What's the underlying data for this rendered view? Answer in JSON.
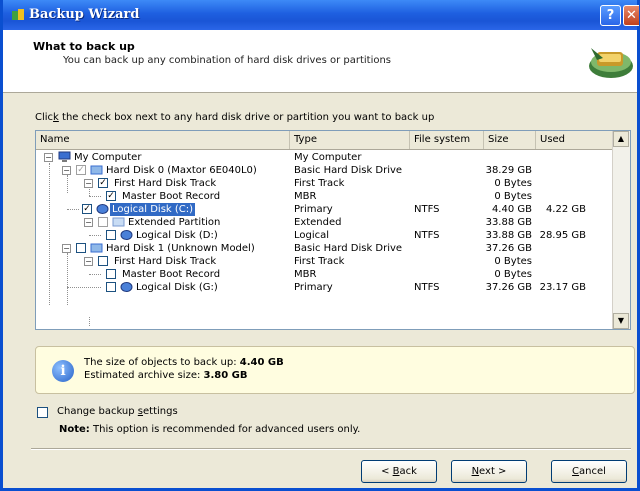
{
  "window": {
    "title": "Backup Wizard",
    "help_label": "?",
    "close_label": "✕"
  },
  "header": {
    "title": "What to back up",
    "subtitle": "You can back up any combination of hard disk drives or partitions"
  },
  "instruction": {
    "prefix": "Clic",
    "accel": "k",
    "rest": " the check box next to any hard disk drive or partition you want to back up"
  },
  "tree": {
    "columns": {
      "name": "Name",
      "type": "Type",
      "fs": "File system",
      "size": "Size",
      "used": "Used"
    },
    "rows": [
      {
        "name": "My Computer",
        "type": "My Computer",
        "fs": "",
        "size": "",
        "used": ""
      },
      {
        "name": "Hard Disk 0 (Maxtor 6E040L0)",
        "type": "Basic Hard Disk Drive",
        "fs": "",
        "size": "38.29 GB",
        "used": ""
      },
      {
        "name": "First Hard Disk Track",
        "type": "First Track",
        "fs": "",
        "size": "0 Bytes",
        "used": ""
      },
      {
        "name": "Master Boot Record",
        "type": "MBR",
        "fs": "",
        "size": "0 Bytes",
        "used": ""
      },
      {
        "name": "Logical Disk (C:)",
        "type": "Primary",
        "fs": "NTFS",
        "size": "4.40 GB",
        "used": "4.22 GB"
      },
      {
        "name": "Extended Partition",
        "type": "Extended",
        "fs": "",
        "size": "33.88 GB",
        "used": ""
      },
      {
        "name": "Logical Disk (D:)",
        "type": "Logical",
        "fs": "NTFS",
        "size": "33.88 GB",
        "used": "28.95 GB"
      },
      {
        "name": "Hard Disk 1 (Unknown Model)",
        "type": "Basic Hard Disk Drive",
        "fs": "",
        "size": "37.26 GB",
        "used": ""
      },
      {
        "name": "First Hard Disk Track",
        "type": "First Track",
        "fs": "",
        "size": "0 Bytes",
        "used": ""
      },
      {
        "name": "Master Boot Record",
        "type": "MBR",
        "fs": "",
        "size": "0 Bytes",
        "used": ""
      },
      {
        "name": "Logical Disk (G:)",
        "type": "Primary",
        "fs": "NTFS",
        "size": "37.26 GB",
        "used": "23.17 GB"
      }
    ]
  },
  "info": {
    "line1_prefix": "The size of objects to back up: ",
    "line1_value": "4.40 GB",
    "line2_prefix": "Estimated archive size: ",
    "line2_value": "3.80 GB"
  },
  "options": {
    "change_settings": {
      "prefix": "Change backup ",
      "accel": "s",
      "rest": "ettings"
    },
    "note_label": "Note:",
    "note_text": " This option is recommended for advanced users only."
  },
  "buttons": {
    "back": {
      "prefix": "< ",
      "accel": "B",
      "rest": "ack"
    },
    "next": {
      "prefix": "",
      "accel": "N",
      "rest": "ext >"
    },
    "cancel": {
      "prefix": "",
      "accel": "C",
      "rest": "ancel"
    }
  },
  "colors": {
    "titlebar": "#1e5fe0",
    "selection": "#316ac5",
    "info_bg": "#fffde0"
  }
}
